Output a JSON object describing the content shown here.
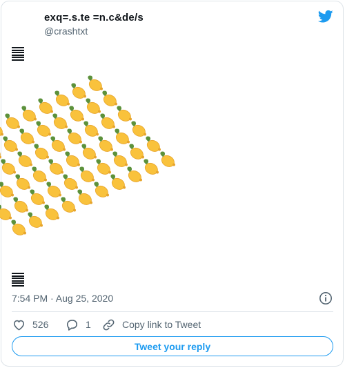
{
  "author": {
    "display_name": "exq=.s.te =n.c&de/s",
    "handle": "@crashtxt"
  },
  "icons": {
    "brand": "twitter-bird-icon",
    "info": "info-icon",
    "like": "heart-icon",
    "reply": "reply-bubble-icon",
    "copy": "link-icon",
    "top_glyph": "horizontal-bars-glyph",
    "bottom_glyph": "horizontal-bars-glyph"
  },
  "tweet": {
    "body_emoji": "lemon",
    "emoji_count": 60,
    "timestamp": "7:54 PM · Aug 25, 2020"
  },
  "actions": {
    "like_count": "526",
    "reply_count": "1",
    "copy_link_label": "Copy link to Tweet"
  },
  "reply_button_label": "Tweet your reply",
  "colors": {
    "brand_blue": "#1d9bf0",
    "lemon": "#f9c23c",
    "leaf": "#5c913b",
    "secondary_text": "#536471"
  }
}
